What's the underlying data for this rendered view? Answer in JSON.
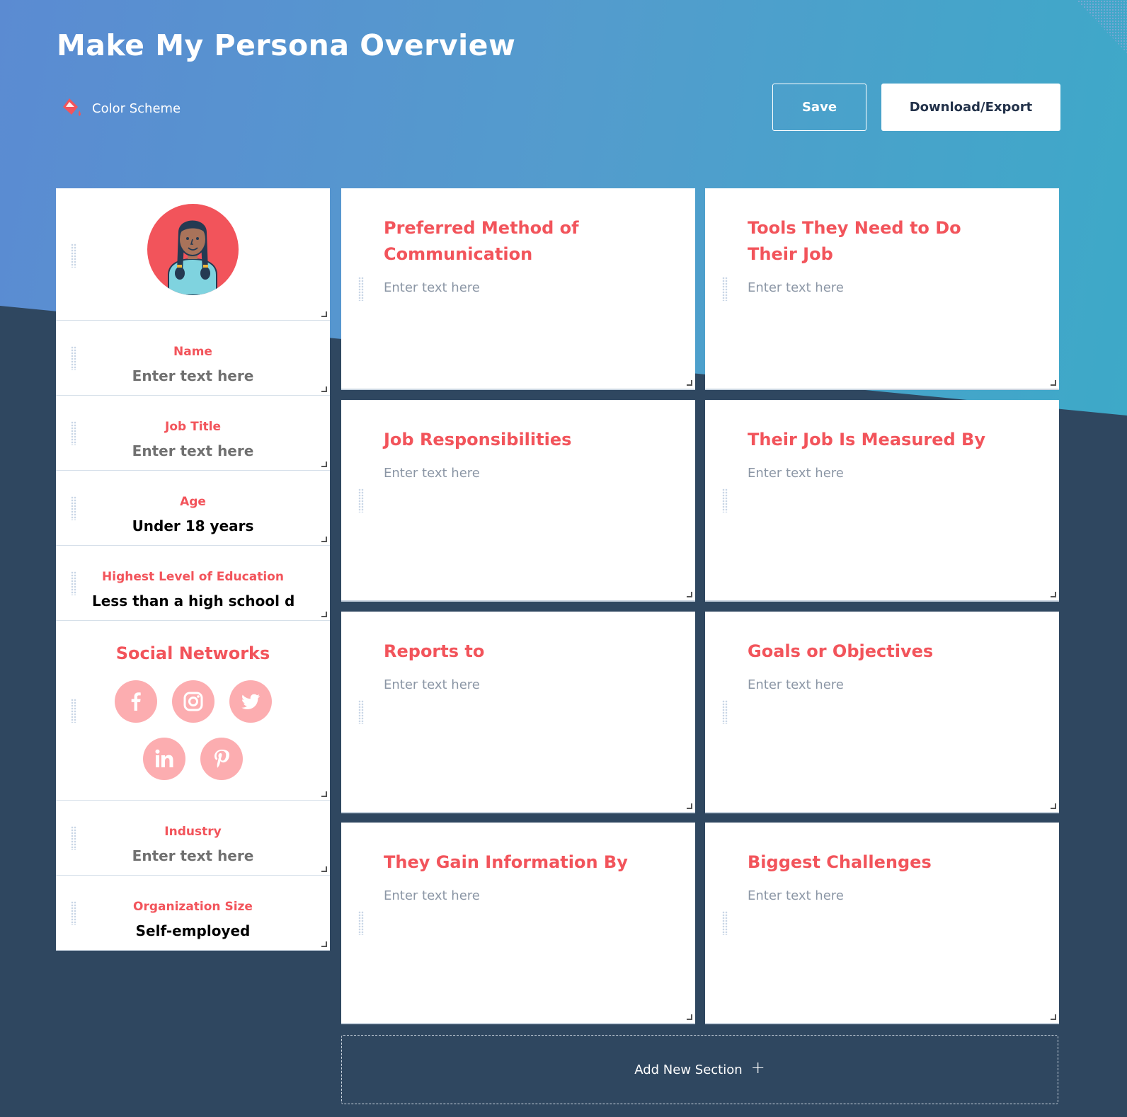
{
  "header": {
    "title": "Make My Persona Overview",
    "color_scheme_label": "Color Scheme",
    "save_label": "Save",
    "export_label": "Download/Export"
  },
  "colors": {
    "accent": "#f2545b",
    "social_bg": "#fcadb0",
    "dark_bg": "#2f4760",
    "button_text": "#23324a"
  },
  "profile": {
    "avatar_icon": "persona-avatar-girl-braids",
    "fields": [
      {
        "label": "Name",
        "value": "Enter text here",
        "is_placeholder": true
      },
      {
        "label": "Job Title",
        "value": "Enter text here",
        "is_placeholder": true
      },
      {
        "label": "Age",
        "value": "Under 18 years",
        "is_placeholder": false
      },
      {
        "label": "Highest Level of Education",
        "value": "Less than a high school diploma",
        "is_placeholder": false
      }
    ],
    "social": {
      "label": "Social Networks",
      "networks": [
        "facebook",
        "instagram",
        "twitter",
        "linkedin",
        "pinterest"
      ]
    },
    "fields_bottom": [
      {
        "label": "Industry",
        "value": "Enter text here",
        "is_placeholder": true
      },
      {
        "label": "Organization Size",
        "value": "Self-employed",
        "is_placeholder": false
      }
    ]
  },
  "sections": [
    {
      "title": "Preferred Method of Communication",
      "placeholder": "Enter text here"
    },
    {
      "title": "Tools They Need to Do Their Job",
      "placeholder": "Enter text here"
    },
    {
      "title": "Job Responsibilities",
      "placeholder": "Enter text here"
    },
    {
      "title": "Their Job Is Measured By",
      "placeholder": "Enter text here"
    },
    {
      "title": "Reports to",
      "placeholder": "Enter text here"
    },
    {
      "title": "Goals or Objectives",
      "placeholder": "Enter text here"
    },
    {
      "title": "They Gain Information By",
      "placeholder": "Enter text here"
    },
    {
      "title": "Biggest Challenges",
      "placeholder": "Enter text here"
    }
  ],
  "add_section": {
    "label": "Add New Section",
    "icon": "plus-icon"
  }
}
